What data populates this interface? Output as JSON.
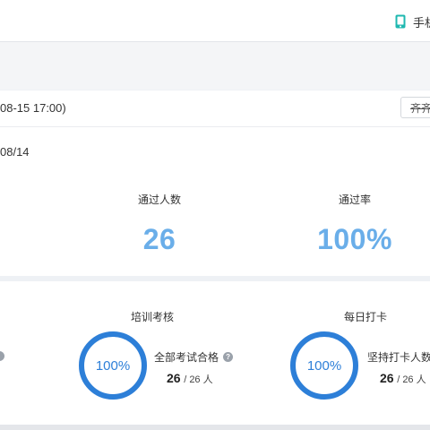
{
  "topbar": {
    "mobile_label": "手机"
  },
  "period": {
    "range_text": "08-15 17:00)",
    "button_label": "齐齐哈"
  },
  "stats": {
    "date_text": "08/14",
    "passed_label": "通过人数",
    "passed_value": "26",
    "pass_rate_label": "通过率",
    "pass_rate_value": "100%"
  },
  "training": {
    "title": "培训考核",
    "ring_text": "100%",
    "progress_fraction": 1.0,
    "metric_label": "全部考试合格",
    "count": "26",
    "total_text": "/ 26 人"
  },
  "checkin": {
    "title": "每日打卡",
    "ring_text": "100%",
    "progress_fraction": 1.0,
    "metric_label": "坚持打卡人数",
    "count": "26",
    "total_text": "/ 26 人"
  },
  "colors": {
    "accent": "#2d7fd8",
    "value_blue": "#6aaee9",
    "phone_icon": "#1fb8b0"
  },
  "icons": {
    "mobile": "phone-icon",
    "help": "help-icon"
  }
}
